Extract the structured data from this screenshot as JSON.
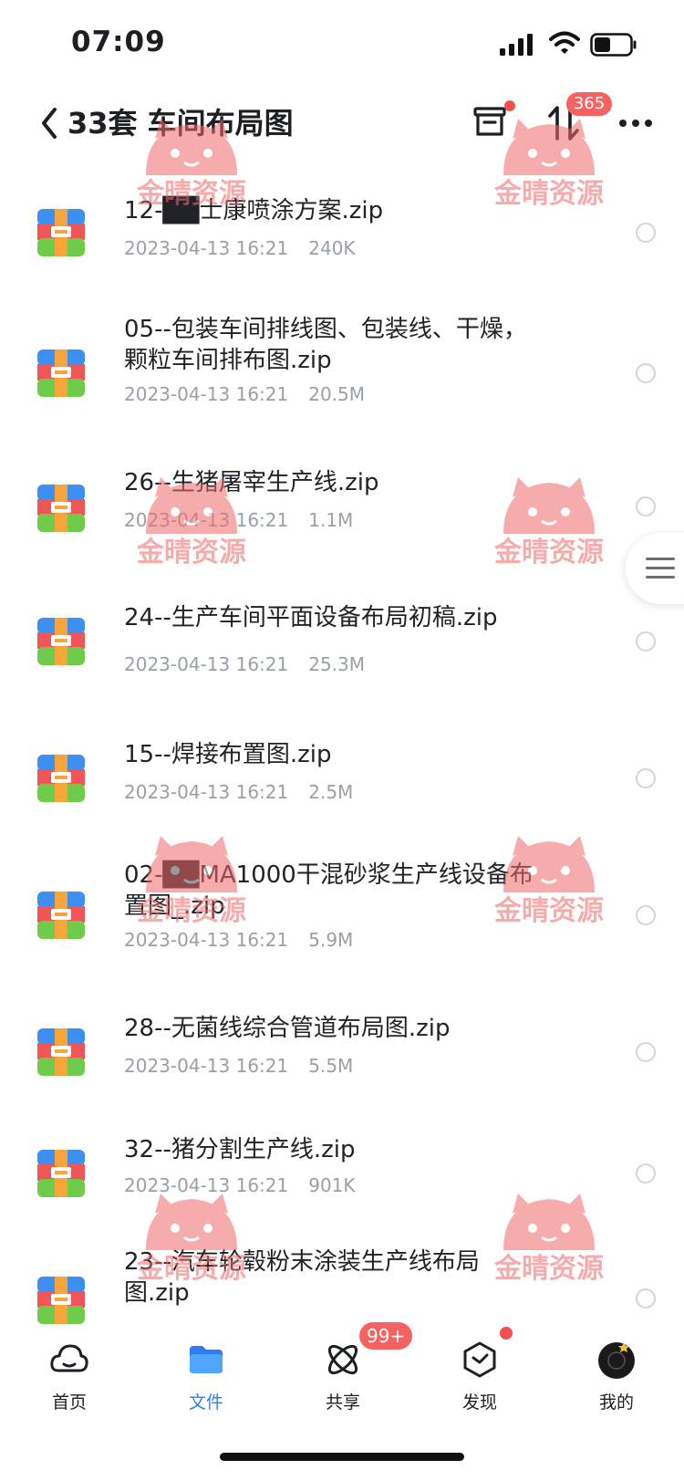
{
  "status_bar": {
    "time": "07:09"
  },
  "header": {
    "title": "33套 车间布局图",
    "transfer_badge": "365"
  },
  "files": [
    {
      "name": "12-██士康喷涂方案.zip",
      "date": "2023-04-13 16:21",
      "size": "240K"
    },
    {
      "name": "05--包装车间排线图、包装线、干燥，颗粒车间排布图.zip",
      "date": "2023-04-13 16:21",
      "size": "20.5M"
    },
    {
      "name": "26--生猪屠宰生产线.zip",
      "date": "2023-04-13 16:21",
      "size": "1.1M"
    },
    {
      "name": "24--生产车间平面设备布局初稿.zip",
      "date": "2023-04-13 16:21",
      "size": "25.3M"
    },
    {
      "name": "15--焊接布置图.zip",
      "date": "2023-04-13 16:21",
      "size": "2.5M"
    },
    {
      "name": "02-██MA1000干混砂浆生产线设备布置图_.zip",
      "date": "2023-04-13 16:21",
      "size": "5.9M"
    },
    {
      "name": "28--无菌线综合管道布局图.zip",
      "date": "2023-04-13 16:21",
      "size": "5.5M"
    },
    {
      "name": "32--猪分割生产线.zip",
      "date": "2023-04-13 16:21",
      "size": "901K"
    },
    {
      "name": "23--汽车轮毂粉末涂装生产线布局图.zip",
      "date": "",
      "size": ""
    }
  ],
  "watermark_text": "金晴资源",
  "bottom_nav": {
    "items": [
      {
        "label": "首页",
        "icon": "cloud-icon"
      },
      {
        "label": "文件",
        "icon": "folder-icon"
      },
      {
        "label": "共享",
        "icon": "share-orbit-icon"
      },
      {
        "label": "发现",
        "icon": "discover-cube-icon"
      },
      {
        "label": "我的",
        "icon": "avatar-icon"
      }
    ],
    "active": "文件",
    "share_badge": "99+"
  },
  "colors": {
    "accent": "#2f7cf6",
    "badge": "#f56262",
    "meta_text": "#9aa0a8"
  }
}
